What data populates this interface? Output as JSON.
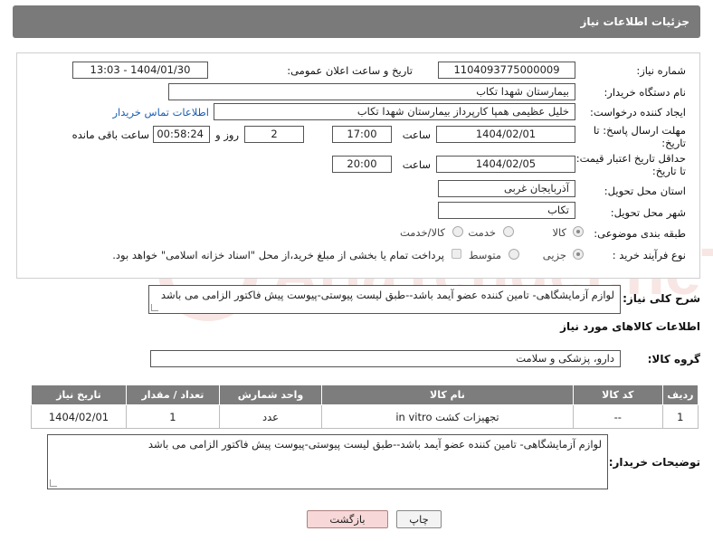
{
  "header": {
    "title": "جزئیات اطلاعات نیاز"
  },
  "form": {
    "need_number_label": "شماره نیاز:",
    "need_number": "1104093775000009",
    "announce_label": "تاریخ و ساعت اعلان عمومی:",
    "announce_value": "1404/01/30 - 13:03",
    "buyer_org_label": "نام دستگاه خریدار:",
    "buyer_org": "بیمارستان شهدا تکاب",
    "creator_label": "ایجاد کننده درخواست:",
    "creator": "خلیل عظیمی همپا کارپرداز بیمارستان شهدا تکاب",
    "contact_link": "اطلاعات تماس خریدار",
    "deadline_label_1": "مهلت ارسال پاسخ: تا",
    "deadline_label_2": "تاریخ:",
    "deadline_date": "1404/02/01",
    "time_label": "ساعت",
    "deadline_time": "17:00",
    "days_value": "2",
    "days_label": "روز و",
    "remaining_time": "00:58:24",
    "remaining_label": "ساعت باقی مانده",
    "min_validity_label_1": "حداقل تاریخ اعتبار قیمت:",
    "min_validity_label_2": "تا تاریخ:",
    "validity_date": "1404/02/05",
    "validity_time": "20:00",
    "province_label": "استان محل تحویل:",
    "province": "آذربایجان غربی",
    "city_label": "شهر محل تحویل:",
    "city": "تکاب",
    "category_label": "طبقه بندی موضوعی:",
    "category_options": [
      "کالا",
      "خدمت",
      "کالا/خدمت"
    ],
    "process_label": "نوع فرآیند خرید :",
    "process_options": [
      "جزیی",
      "متوسط"
    ],
    "payment_note": "پرداخت تمام یا بخشی از مبلغ خرید،از محل \"اسناد خزانه اسلامی\" خواهد بود."
  },
  "description": {
    "label": "شرح کلی نیاز:",
    "text": "لوازم آزمایشگاهی- تامین کننده عضو آیمد باشد--طبق لیست پیوستی-پیوست پیش فاکتور الزامی می باشد"
  },
  "goods": {
    "section_title": "اطلاعات کالاهای مورد نیاز",
    "group_label": "گروه کالا:",
    "group_value": "دارو، پزشکی و سلامت",
    "columns": [
      "ردیف",
      "کد کالا",
      "نام کالا",
      "واحد شمارش",
      "تعداد / مقدار",
      "تاریخ نیاز"
    ],
    "rows": [
      {
        "index": "1",
        "code": "--",
        "name": "تجهیزات کشت in vitro",
        "unit": "عدد",
        "qty": "1",
        "date": "1404/02/01"
      }
    ]
  },
  "buyer_notes": {
    "label": "توضیحات خریدار:",
    "text": "لوازم آزمایشگاهی- تامین کننده عضو آیمد باشد--طبق لیست پیوستی-پیوست پیش فاکتور الزامی می باشد"
  },
  "buttons": {
    "print": "چاپ",
    "back": "بازگشت"
  },
  "watermark": {
    "text": "AriaTender.neT"
  },
  "colors": {
    "header_bg": "#7a7a7a",
    "link": "#1a5fb4",
    "back_button": "#f7d7d7"
  }
}
